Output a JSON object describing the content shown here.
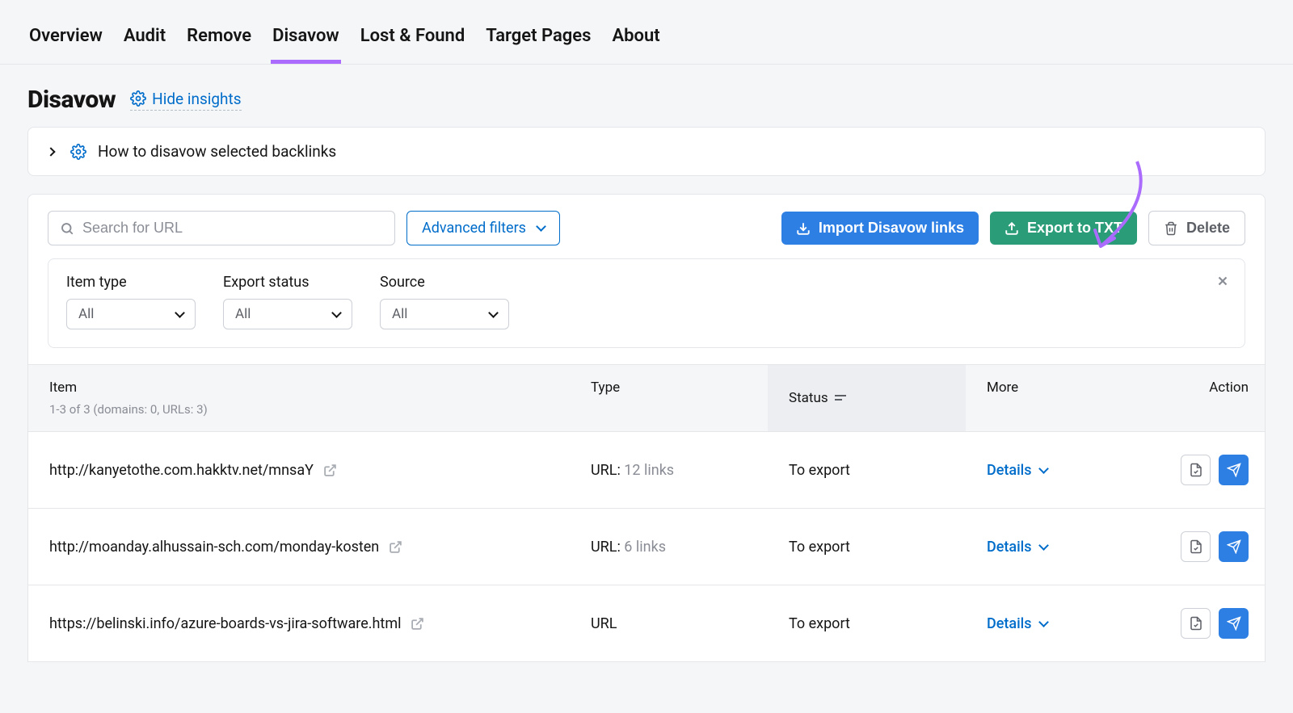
{
  "tabs": [
    "Overview",
    "Audit",
    "Remove",
    "Disavow",
    "Lost & Found",
    "Target Pages",
    "About"
  ],
  "active_tab": "Disavow",
  "page_title": "Disavow",
  "hide_insights": "Hide insights",
  "help_panel": "How to disavow selected backlinks",
  "search_placeholder": "Search for URL",
  "advanced_filters": "Advanced filters",
  "buttons": {
    "import": "Import Disavow links",
    "export": "Export to TXT",
    "delete": "Delete"
  },
  "filters": {
    "item_type": {
      "label": "Item type",
      "value": "All"
    },
    "export_status": {
      "label": "Export status",
      "value": "All"
    },
    "source": {
      "label": "Source",
      "value": "All"
    }
  },
  "columns": {
    "item": "Item",
    "item_sub": "1-3 of 3 (domains: 0, URLs: 3)",
    "type": "Type",
    "status": "Status",
    "more": "More",
    "action": "Action"
  },
  "details_label": "Details",
  "rows": [
    {
      "url": "http://kanyetothe.com.hakktv.net/mnsaY",
      "type_label": "URL:",
      "type_count": "12 links",
      "status": "To export"
    },
    {
      "url": "http://moanday.alhussain-sch.com/monday-kosten",
      "type_label": "URL:",
      "type_count": "6 links",
      "status": "To export"
    },
    {
      "url": "https://belinski.info/azure-boards-vs-jira-software.html",
      "type_label": "URL",
      "type_count": "",
      "status": "To export"
    }
  ],
  "colors": {
    "tab_active": "#ab6cfe",
    "blue": "#2e7fe3",
    "green": "#2a9d78",
    "link": "#006dca"
  }
}
